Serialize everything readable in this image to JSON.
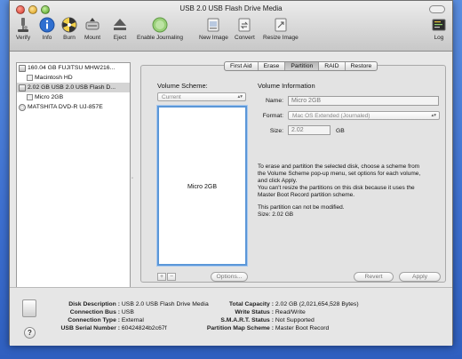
{
  "window": {
    "title": "USB 2.0 USB Flash Drive Media"
  },
  "toolbar": {
    "verify": "Verify",
    "info": "Info",
    "burn": "Burn",
    "mount": "Mount",
    "eject": "Eject",
    "enable_journaling": "Enable Journaling",
    "new_image": "New Image",
    "convert": "Convert",
    "resize_image": "Resize Image",
    "log": "Log"
  },
  "sidebar": {
    "items": [
      {
        "label": "160.04 GB FUJITSU MHW216...",
        "kind": "disk"
      },
      {
        "label": "Macintosh HD",
        "kind": "volume"
      },
      {
        "label": "2.02 GB USB 2.0 USB Flash D...",
        "kind": "disk"
      },
      {
        "label": "Micro 2GB",
        "kind": "volume"
      },
      {
        "label": "MATSHITA DVD-R UJ-857E",
        "kind": "optical"
      }
    ]
  },
  "tabs": [
    "First Aid",
    "Erase",
    "Partition",
    "RAID",
    "Restore"
  ],
  "partition": {
    "volume_scheme_label": "Volume Scheme:",
    "volume_scheme_value": "Current",
    "partition_name": "Micro 2GB",
    "add": "+",
    "remove": "−",
    "options": "Options..."
  },
  "volume_info": {
    "heading": "Volume Information",
    "name_label": "Name:",
    "name_value": "Micro 2GB",
    "format_label": "Format:",
    "format_value": "Mac OS Extended (Journaled)",
    "size_label": "Size:",
    "size_value": "2.02",
    "size_unit": "GB",
    "desc1": "To erase and partition the selected disk, choose a scheme from",
    "desc2": "the Volume Scheme pop-up menu, set options for each volume,",
    "desc3": "and click Apply.",
    "desc4": "You can't resize the partitions on this disk because it uses the",
    "desc5": "Master Boot Record partition scheme.",
    "desc6": "This partition can not be modified.",
    "desc7": "Size: 2.02 GB"
  },
  "buttons": {
    "revert": "Revert",
    "apply": "Apply"
  },
  "footer": {
    "disk_description_label": "Disk Description :",
    "disk_description_value": "USB 2.0 USB Flash Drive Media",
    "connection_bus_label": "Connection Bus :",
    "connection_bus_value": "USB",
    "connection_type_label": "Connection Type :",
    "connection_type_value": "External",
    "usb_serial_label": "USB Serial Number :",
    "usb_serial_value": "60424824b2c67f",
    "total_capacity_label": "Total Capacity :",
    "total_capacity_value": "2.02 GB (2,021,654,528 Bytes)",
    "write_status_label": "Write Status :",
    "write_status_value": "Read/Write",
    "smart_status_label": "S.M.A.R.T. Status :",
    "smart_status_value": "Not Supported",
    "partition_map_label": "Partition Map Scheme :",
    "partition_map_value": "Master Boot Record",
    "help": "?"
  }
}
